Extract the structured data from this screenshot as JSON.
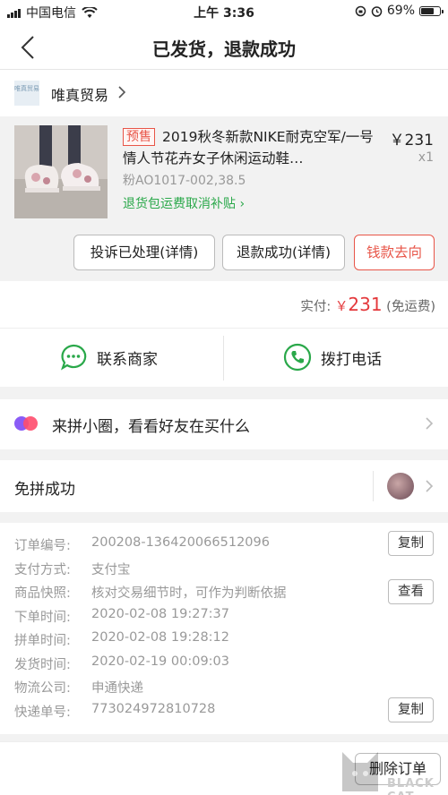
{
  "status_bar": {
    "carrier": "中国电信",
    "time": "上午 3:36",
    "battery": "69%"
  },
  "nav": {
    "title": "已发货，退款成功"
  },
  "shop": {
    "logo_text": "唯真贸易",
    "name": "唯真贸易"
  },
  "product": {
    "tag": "预售",
    "title": "2019秋冬新款NIKE耐克空军/一号情人节花卉女子休闲运动鞋…",
    "price": "￥231",
    "qty": "x1",
    "sku": "粉AO1017-002,38.5",
    "shipping_note": "退货包运费取消补贴"
  },
  "actions": {
    "complaint": "投诉已处理(详情)",
    "refund": "退款成功(详情)",
    "money": "钱款去向"
  },
  "payment": {
    "label": "实付:",
    "currency": "￥",
    "amount": "231",
    "note": "(免运费)"
  },
  "contact": {
    "merchant": "联系商家",
    "call": "拨打电话"
  },
  "circle": {
    "text": "来拼小圈，看看好友在买什么"
  },
  "group": {
    "text": "免拼成功"
  },
  "order_info": {
    "rows": [
      {
        "k": "订单编号:",
        "v": "200208-136420066512096"
      },
      {
        "k": "支付方式:",
        "v": "支付宝"
      },
      {
        "k": "商品快照:",
        "v": "核对交易细节时，可作为判断依据"
      },
      {
        "k": "下单时间:",
        "v": "2020-02-08 19:27:37"
      },
      {
        "k": "拼单时间:",
        "v": "2020-02-08 19:28:12"
      },
      {
        "k": "发货时间:",
        "v": "2020-02-19 00:09:03"
      },
      {
        "k": "物流公司:",
        "v": "申通快递"
      },
      {
        "k": "快递单号:",
        "v": "773024972810728"
      }
    ],
    "copy_label": "复制",
    "view_label": "查看"
  },
  "bottom": {
    "delete_label": "删除订单"
  },
  "watermark": {
    "text": "BLACK CAT"
  },
  "colors": {
    "red": "#e4393c",
    "green": "#2aa84a"
  }
}
